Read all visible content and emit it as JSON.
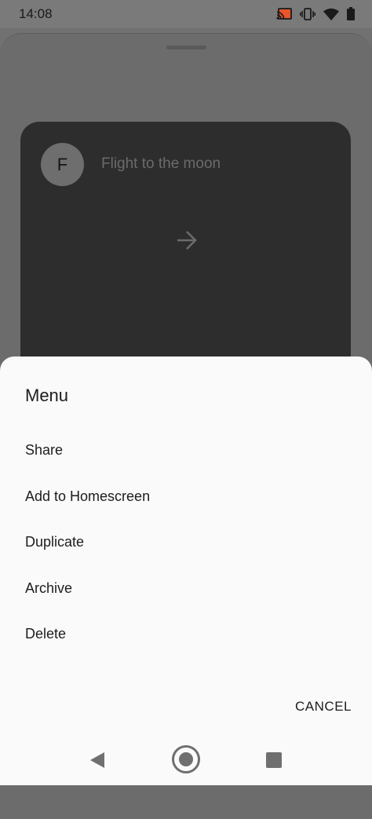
{
  "status_bar": {
    "time": "14:08",
    "icons": [
      "cast-icon",
      "vibrate-icon",
      "wifi-icon",
      "battery-icon"
    ]
  },
  "background": {
    "card": {
      "avatar_letter": "F",
      "title": "Flight to the moon",
      "icon": "arrow-right-icon"
    }
  },
  "menu": {
    "title": "Menu",
    "items": [
      {
        "label": "Share"
      },
      {
        "label": "Add to Homescreen"
      },
      {
        "label": "Duplicate"
      },
      {
        "label": "Archive"
      },
      {
        "label": "Delete"
      }
    ],
    "cancel_label": "CANCEL"
  },
  "nav_bar": {
    "icons": [
      "back-icon",
      "home-icon",
      "recents-icon"
    ]
  }
}
